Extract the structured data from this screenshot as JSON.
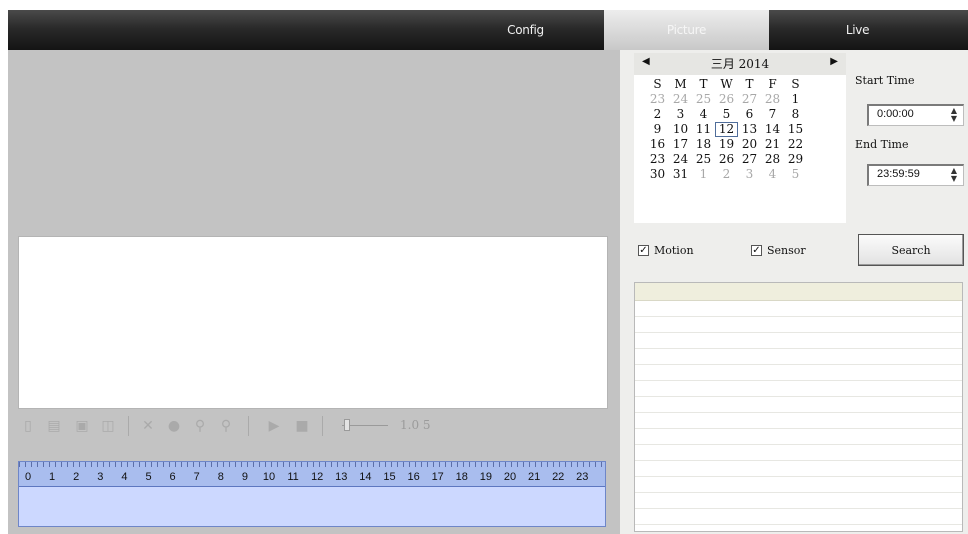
{
  "tabs": [
    {
      "id": "config",
      "label": "Config"
    },
    {
      "id": "picture",
      "label": "Picture",
      "active": true
    },
    {
      "id": "live",
      "label": "Live"
    }
  ],
  "toolbar": {
    "icons": [
      "open-file-icon",
      "open-folder-icon",
      "save-icon",
      "snapshot-icon",
      "stop-icon",
      "record-icon",
      "zoom-in-icon",
      "zoom-out-icon",
      "play-icon",
      "pause-icon"
    ],
    "speed_value": "1.0 5"
  },
  "timeline": {
    "hours": [
      "0",
      "1",
      "2",
      "3",
      "4",
      "5",
      "6",
      "7",
      "8",
      "9",
      "10",
      "11",
      "12",
      "13",
      "14",
      "15",
      "16",
      "17",
      "18",
      "19",
      "20",
      "21",
      "22",
      "23"
    ]
  },
  "calendar": {
    "prev": "◀",
    "next": "▶",
    "title": "三月 2014",
    "weekdays": [
      "S",
      "M",
      "T",
      "W",
      "T",
      "F",
      "S"
    ],
    "weeks": [
      [
        "23",
        "24",
        "25",
        "26",
        "27",
        "28",
        "1"
      ],
      [
        "2",
        "3",
        "4",
        "5",
        "6",
        "7",
        "8"
      ],
      [
        "9",
        "10",
        "11",
        "12",
        "13",
        "14",
        "15"
      ],
      [
        "16",
        "17",
        "18",
        "19",
        "20",
        "21",
        "22"
      ],
      [
        "23",
        "24",
        "25",
        "26",
        "27",
        "28",
        "29"
      ],
      [
        "30",
        "31",
        "1",
        "2",
        "3",
        "4",
        "5"
      ]
    ],
    "selected_day": "12"
  },
  "start_time": {
    "label": "Start Time",
    "value": "0:00:00"
  },
  "end_time": {
    "label": "End Time",
    "value": "23:59:59"
  },
  "filters": {
    "motion": {
      "label": "Motion",
      "checked": true
    },
    "sensor": {
      "label": "Sensor",
      "checked": true
    }
  },
  "search_button": {
    "label": "Search"
  },
  "colors": {
    "topbar": "#1f1f1f",
    "panel_bg": "#c3c3c3",
    "timeline": "#ccd8ff",
    "timeline_border": "#6e86c8"
  }
}
